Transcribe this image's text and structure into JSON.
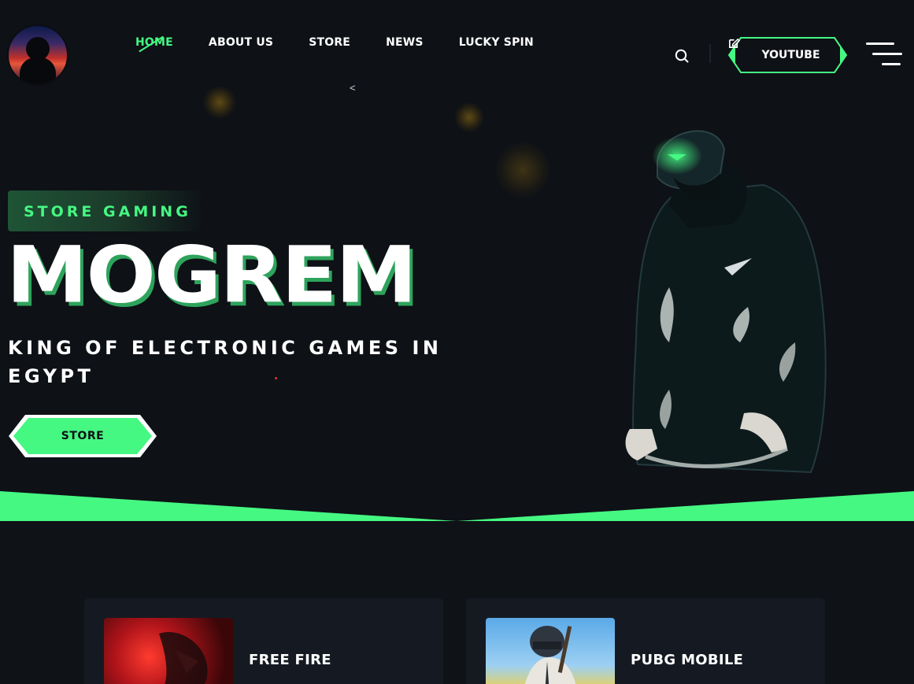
{
  "header": {
    "nav": [
      {
        "label": "HOME",
        "active": true
      },
      {
        "label": "ABOUT US",
        "active": false
      },
      {
        "label": "STORE",
        "active": false
      },
      {
        "label": "NEWS",
        "active": false
      },
      {
        "label": "LUCKY SPIN",
        "active": false
      }
    ],
    "nav_chevron": "<",
    "youtube_button": "YOUTUBE",
    "icons": {
      "search": "search-icon",
      "edit": "edit-icon",
      "menu": "hamburger-menu-icon"
    }
  },
  "hero": {
    "tagline": "STORE GAMING",
    "headline": "MOGREM",
    "subtitle": "KING OF ELECTRONIC GAMES IN EGYPT",
    "cta_label": "STORE"
  },
  "games": [
    {
      "title": "FREE FIRE"
    },
    {
      "title": "PUBG MOBILE"
    }
  ],
  "colors": {
    "accent": "#45f882",
    "background": "#0f1217",
    "card": "#151a22"
  }
}
